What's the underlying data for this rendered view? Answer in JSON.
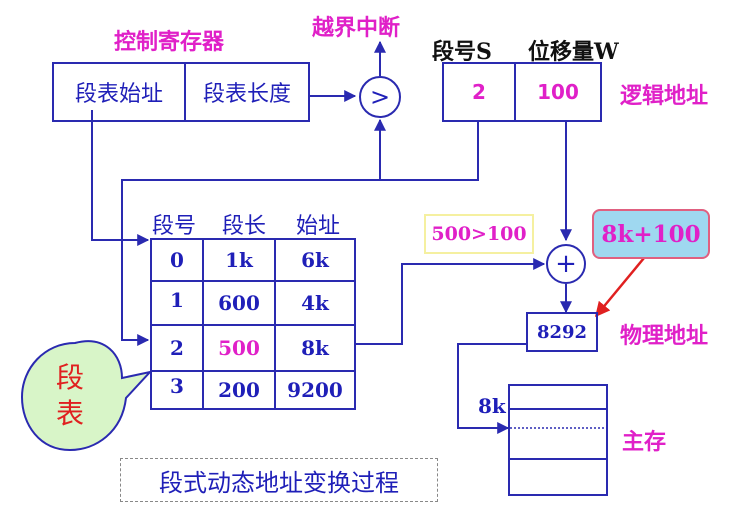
{
  "control_register": {
    "title": "控制寄存器",
    "fields": [
      "段表始址",
      "段表长度"
    ]
  },
  "out_of_bounds_interrupt": "越界中断",
  "compare_symbol": ">",
  "logical_address": {
    "headers": [
      "段号S",
      "位移量W"
    ],
    "values": [
      "2",
      "100"
    ],
    "label": "逻辑地址"
  },
  "segment_table": {
    "headers": [
      "段号",
      "段长",
      "始址"
    ],
    "rows": [
      {
        "segment": "0",
        "length": "1k",
        "base": "6k"
      },
      {
        "segment": "1",
        "length": "600",
        "base": "4k"
      },
      {
        "segment": "2",
        "length": "500",
        "base": "8k"
      },
      {
        "segment": "3",
        "length": "200",
        "base": "9200"
      }
    ],
    "highlight_row_index": 2
  },
  "compare_note": "500>100",
  "adder_symbol": "+",
  "sum_callout": "8k+100",
  "physical_address": {
    "value": "8292",
    "label": "物理地址"
  },
  "memory": {
    "offset_label": "8k",
    "label": "主存"
  },
  "segment_table_callout": {
    "chars": [
      "段",
      "表"
    ]
  },
  "caption": "段式动态地址变换过程",
  "colors": {
    "line": "#2a2ab0",
    "text_blue": "#1f1fb8",
    "magenta": "#e020c8",
    "callout_green": "#d8f5c8",
    "callout_blue_fill": "#9fd8f0",
    "arrow_red": "#e02020"
  }
}
